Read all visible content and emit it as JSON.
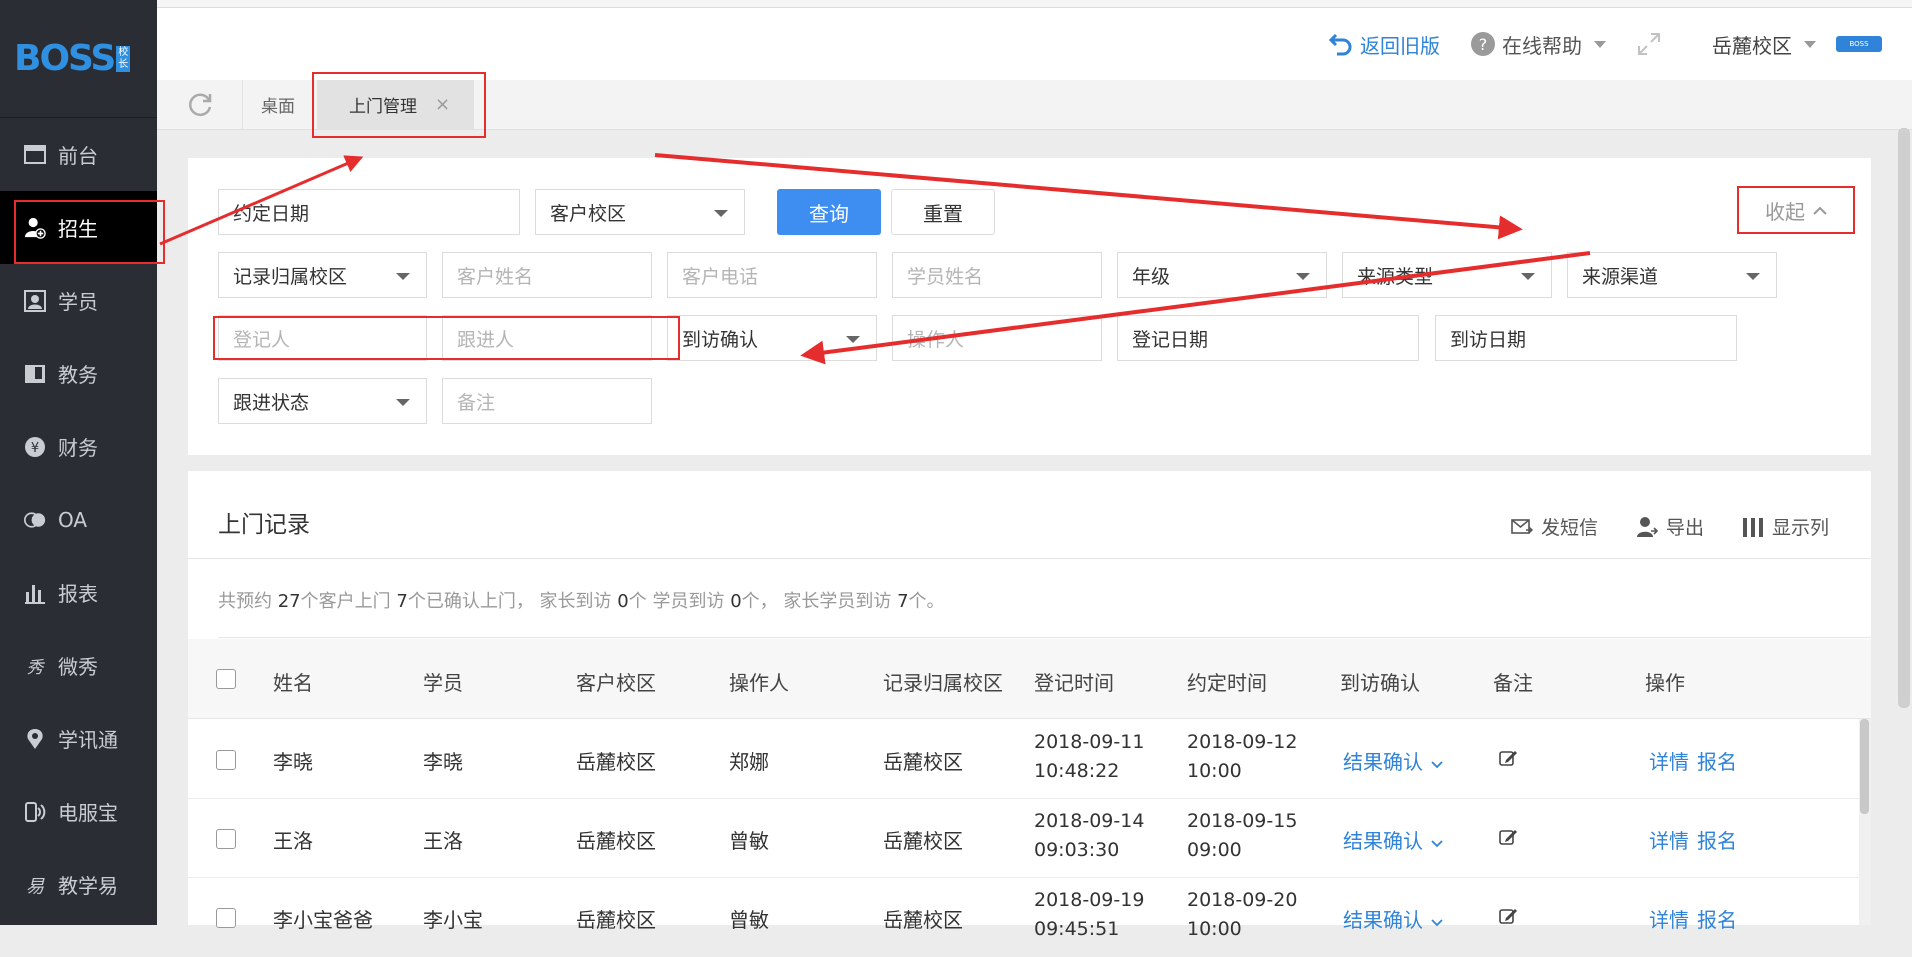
{
  "sidebar": {
    "logo_text": "BOSS",
    "logo_badge": "校长",
    "items": [
      {
        "label": "前台",
        "icon": "monitor-icon"
      },
      {
        "label": "招生",
        "icon": "user-add-icon",
        "active": true
      },
      {
        "label": "学员",
        "icon": "student-card-icon"
      },
      {
        "label": "教务",
        "icon": "book-icon"
      },
      {
        "label": "财务",
        "icon": "yen-icon"
      },
      {
        "label": "OA",
        "icon": "oa-icon"
      },
      {
        "label": "报表",
        "icon": "bar-chart-icon"
      },
      {
        "label": "微秀",
        "icon": "weixiu-icon"
      },
      {
        "label": "学讯通",
        "icon": "location-icon"
      },
      {
        "label": "电服宝",
        "icon": "phone-service-icon"
      },
      {
        "label": "教学易",
        "icon": "teach-icon"
      }
    ]
  },
  "topbar": {
    "back_label": "返回旧版",
    "help_label": "在线帮助",
    "campus_label": "岳麓校区",
    "avatar_text": "BOSS"
  },
  "tabs": {
    "home": "桌面",
    "active": "上门管理",
    "close": "×"
  },
  "filter": {
    "appoint_date": "约定日期",
    "customer_campus": "客户校区",
    "query": "查询",
    "reset": "重置",
    "collapse": "收起",
    "record_campus": "记录归属校区",
    "customer_name": "客户姓名",
    "customer_phone": "客户电话",
    "student_name": "学员姓名",
    "grade": "年级",
    "source_type": "来源类型",
    "source_channel": "来源渠道",
    "registrar": "登记人",
    "follower": "跟进人",
    "visit_confirm": "到访确认",
    "operator": "操作人",
    "register_date": "登记日期",
    "visit_date": "到访日期",
    "follow_status": "跟进状态",
    "remark": "备注"
  },
  "records": {
    "title": "上门记录",
    "send_sms": "发短信",
    "export": "导出",
    "columns_label": "显示列",
    "summary": {
      "p1": "共预约 ",
      "n1": "27",
      "p2": "个客户上门  ",
      "n2": "7",
      "p3": "个已确认上门， 家长到访 ",
      "n3": "0",
      "p4": "个 学员到访 ",
      "n4": "0",
      "p5": "个， 家长学员到访 ",
      "n5": "7",
      "p6": "个。"
    },
    "headers": [
      "姓名",
      "学员",
      "客户校区",
      "操作人",
      "记录归属校区",
      "登记时间",
      "约定时间",
      "到访确认",
      "备注",
      "操作"
    ],
    "rows": [
      {
        "name": "李晓",
        "student": "李晓",
        "campus": "岳麓校区",
        "operator": "郑娜",
        "record_campus": "岳麓校区",
        "reg_date": "2018-09-11",
        "reg_time": "10:48:22",
        "appt_date": "2018-09-12",
        "appt_time": "10:00",
        "confirm": "结果确认",
        "detail": "详情",
        "enroll": "报名"
      },
      {
        "name": "王洛",
        "student": "王洛",
        "campus": "岳麓校区",
        "operator": "曾敏",
        "record_campus": "岳麓校区",
        "reg_date": "2018-09-14",
        "reg_time": "09:03:30",
        "appt_date": "2018-09-15",
        "appt_time": "09:00",
        "confirm": "结果确认",
        "detail": "详情",
        "enroll": "报名"
      },
      {
        "name": "李小宝爸爸",
        "student": "李小宝",
        "campus": "岳麓校区",
        "operator": "曾敏",
        "record_campus": "岳麓校区",
        "reg_date": "2018-09-19",
        "reg_time": "09:45:51",
        "appt_date": "2018-09-20",
        "appt_time": "10:00",
        "confirm": "结果确认",
        "detail": "详情",
        "enroll": "报名"
      }
    ]
  },
  "colors": {
    "accent": "#3d8ef0",
    "link": "#2f83d9",
    "annotation": "#e52d2d",
    "sidebar": "#2a2d33"
  }
}
